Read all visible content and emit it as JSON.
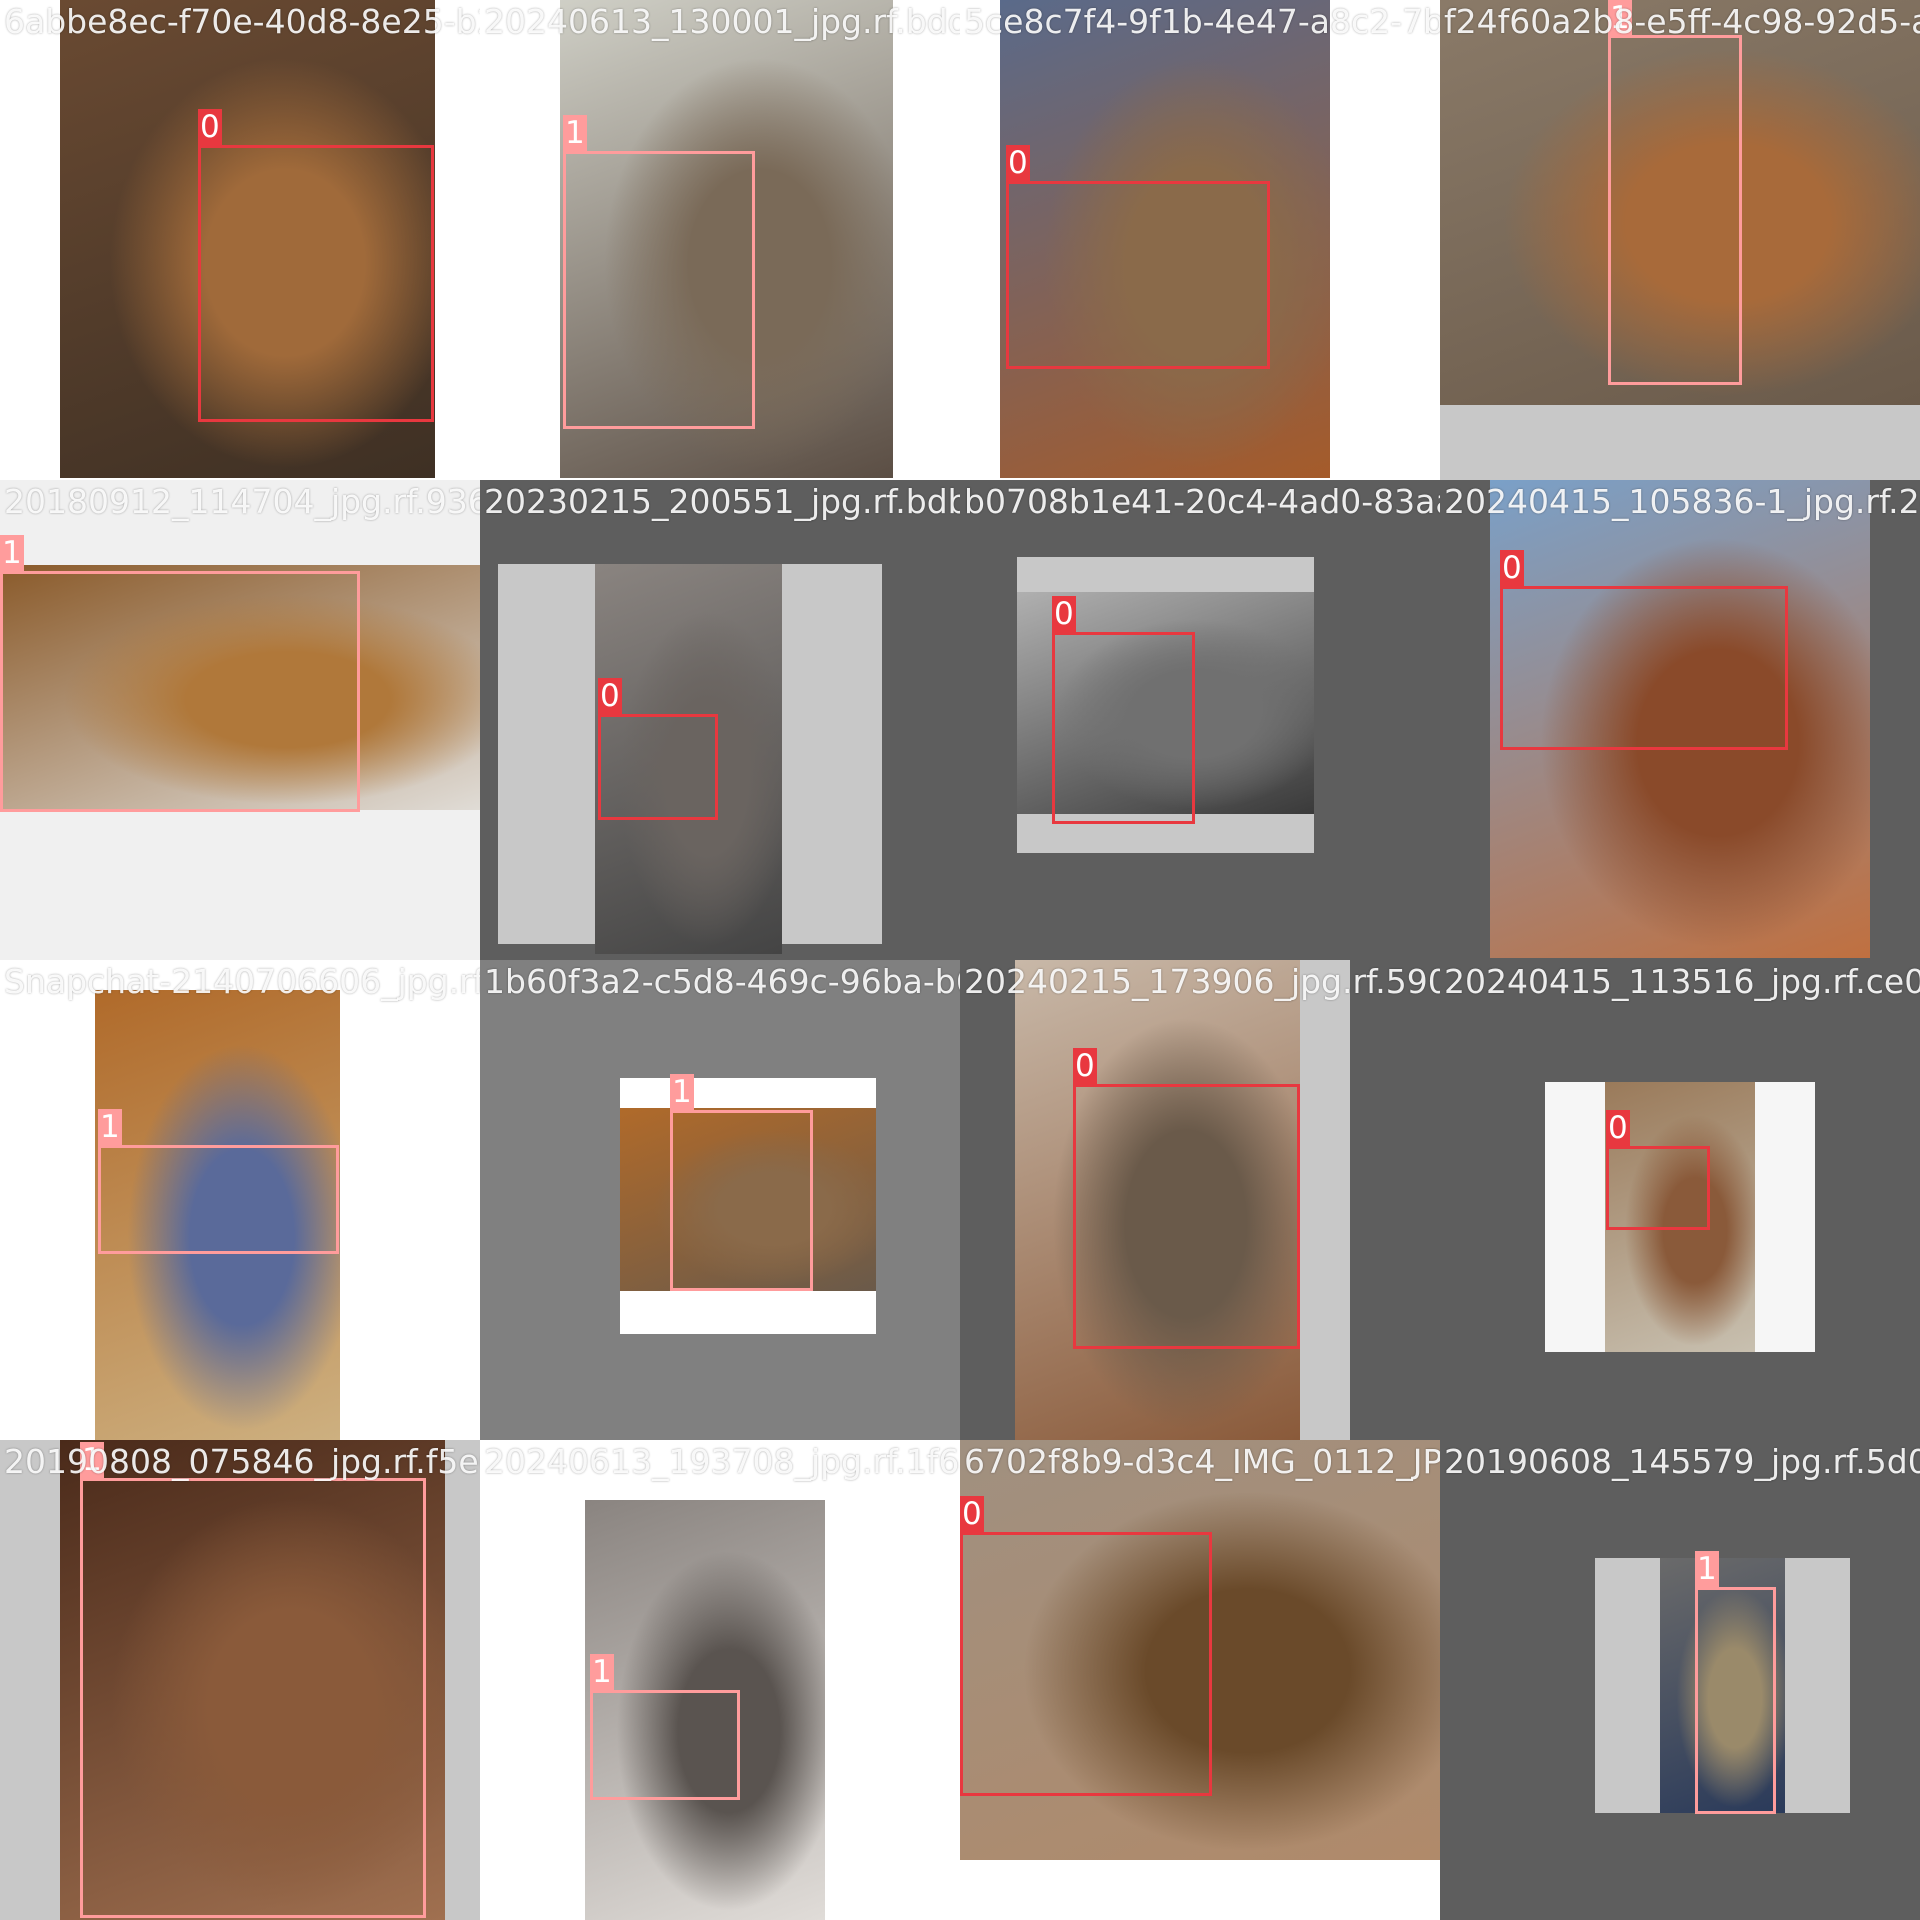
{
  "grid": {
    "columns": 4,
    "rows": 4
  },
  "colors": {
    "class_0": "#e8383f",
    "class_1": "#ff9c9c",
    "bg_white": "#ffffff",
    "bg_dark_gray": "#5e5e5e",
    "bg_mid_gray": "#808080",
    "bg_light_gray": "#c8c8c8"
  },
  "tiles": [
    {
      "filename": "6abbe8ec-f70e-40d8-8e25-b2074a9f50d54018_jpg.rf.271",
      "class_label": "0",
      "background": "#ffffff",
      "photo_colors": [
        "#6a4a32",
        "#a06a3a",
        "#3e3024"
      ]
    },
    {
      "filename": "20240613_130001_jpg.rf.bdd98e1b6c19b0942d3b8ba92c",
      "class_label": "1",
      "background": "#ffffff",
      "photo_colors": [
        "#cfcfc6",
        "#7a6a58",
        "#5b4e44"
      ]
    },
    {
      "filename": "5ce8c7f4-9f1b-4e47-a8c2-7b3f2b9d1e5a_jpg.rf.42460",
      "class_label": "0",
      "background": "#ffffff",
      "photo_colors": [
        "#5a6a8a",
        "#8a6a4a",
        "#a55b2a"
      ]
    },
    {
      "filename": "f24f60a2b8-e5ff-4c98-92d5-ab8e1b3c6f21_jpg.rf.0d",
      "class_label": "1",
      "background": "#5e5e5e",
      "photo_colors": [
        "#8a7a68",
        "#a86a3a",
        "#6a5a4a"
      ]
    },
    {
      "filename": "20180912_114704_jpg.rf.9362c0f4da1b2e5a7c8d9e0f1a",
      "class_label": "1",
      "background": "#f0f0f0",
      "photo_colors": [
        "#8a5a2a",
        "#b0783a",
        "#e0dcd6"
      ]
    },
    {
      "filename": "20230215_200551_jpg.rf.bdb0f1e2d3c4b5a69788",
      "class_label": "0",
      "background": "#5e5e5e",
      "photo_colors": [
        "#8a8480",
        "#6a6460",
        "#444"
      ]
    },
    {
      "filename": "b0708b1e41-20c4-4ad0-83aa-c5ed9a8f7b6c_jpg.rf.1",
      "class_label": "0",
      "background": "#5e5e5e",
      "photo_colors": [
        "#b0b0b0",
        "#707070",
        "#3a3a3a"
      ]
    },
    {
      "filename": "20240415_105836-1_jpg.rf.2e3f4a5b6c7d8e9f0a1b",
      "class_label": "0",
      "background": "#5e5e5e",
      "photo_colors": [
        "#7aa0c8",
        "#8a4a2a",
        "#c07040"
      ]
    },
    {
      "filename": "Snapchat-2140706606_jpg.rf.1b509f3a7e2c4d6b8a0f",
      "class_label": "1",
      "background": "#ffffff",
      "photo_colors": [
        "#b06a2a",
        "#5a6a9a",
        "#cdb080"
      ]
    },
    {
      "filename": "1b60f3a2-c5d8-469c-96ba-b6829e1f4a7c_jpg.rf.6e4",
      "class_label": "1",
      "background": "#808080",
      "photo_colors": [
        "#b06a2a",
        "#8a6a4a",
        "#6a5a4a"
      ]
    },
    {
      "filename": "20240215_173906_jpg.rf.590d2e4f6a8b0c1d3e5f",
      "class_label": "0",
      "background": "#5e5e5e",
      "photo_colors": [
        "#c8b8a8",
        "#6a5a4a",
        "#8a5a3a"
      ]
    },
    {
      "filename": "20240415_113516_jpg.rf.ce0a1b2c3d4e5f6a7b8c",
      "class_label": "0",
      "background": "#5e5e5e",
      "photo_colors": [
        "#9a7a5a",
        "#8a5a3a",
        "#c8c0b0"
      ]
    },
    {
      "filename": "20190808_075846_jpg.rf.f5e0c1d2e3f4a5b6c7d8",
      "class_label": "1",
      "background": "#c8c8c8",
      "photo_colors": [
        "#4a2a1a",
        "#8a5a3a",
        "#a07050"
      ]
    },
    {
      "filename": "20240613_193708_jpg.rf.1f6a7b8c9d0e1f2a3b4c",
      "class_label": "1",
      "background": "#ffffff",
      "photo_colors": [
        "#8a8480",
        "#5a5450",
        "#e0dcd8"
      ]
    },
    {
      "filename": "6702f8b9-d3c4_IMG_0112_JPG.rf.9a8b7c6d5e4f",
      "class_label": "0",
      "background": "#ffffff",
      "photo_colors": [
        "#a09080",
        "#6a4a2a",
        "#b08a6a"
      ]
    },
    {
      "filename": "20190608_145579_jpg.rf.5d0e1f2a3b4c5d6e7f8a",
      "class_label": "1",
      "background": "#5e5e5e",
      "photo_colors": [
        "#6a6a6a",
        "#9a8a6a",
        "#2a3a5a"
      ]
    }
  ]
}
